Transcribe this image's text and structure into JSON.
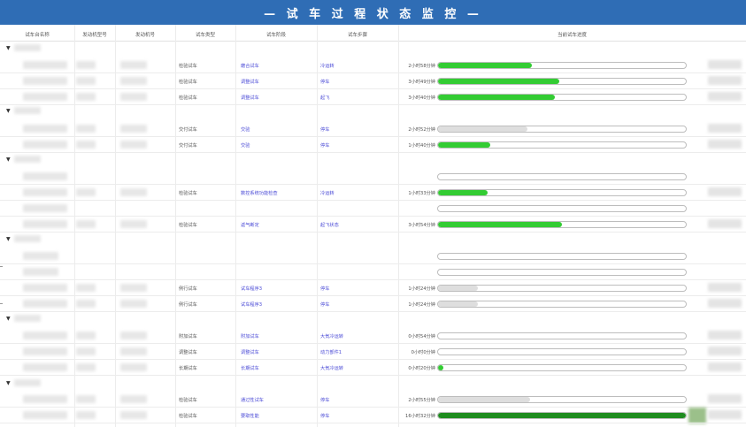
{
  "title": "— 试 车 过 程 状 态 监 控 —",
  "headers": [
    "试车台名称",
    "发动机型号",
    "发动机号",
    "试车类型",
    "试车阶段",
    "试车步骤",
    "当前试车进度"
  ],
  "rows": [
    {
      "type": "检验试车",
      "stage": "磨合试车",
      "step": "冷运转",
      "time": "2小时58分钟",
      "progress": 0.38,
      "color": "green"
    },
    {
      "type": "检验试车",
      "stage": "调整试车",
      "step": "停车",
      "time": "3小时49分钟",
      "progress": 0.49,
      "color": "green"
    },
    {
      "type": "检验试车",
      "stage": "调整试车",
      "step": "起飞",
      "time": "3小时40分钟",
      "progress": 0.47,
      "color": "green"
    },
    {
      "type": "交付试车",
      "stage": "交验",
      "step": "停车",
      "time": "2小时52分钟",
      "progress": 0.36,
      "color": "gray"
    },
    {
      "type": "交付试车",
      "stage": "交验",
      "step": "停车",
      "time": "1小时40分钟",
      "progress": 0.21,
      "color": "green"
    },
    {
      "type": "",
      "stage": "",
      "step": "",
      "time": "",
      "progress": 0,
      "color": "none"
    },
    {
      "type": "检验试车",
      "stage": "数控系统功能检查",
      "step": "冷运转",
      "time": "1小时33分钟",
      "progress": 0.2,
      "color": "green"
    },
    {
      "type": "",
      "stage": "",
      "step": "",
      "time": "",
      "progress": 0,
      "color": "none"
    },
    {
      "type": "检验试车",
      "stage": "返气断定",
      "step": "起飞状态",
      "time": "3小时54分钟",
      "progress": 0.5,
      "color": "green"
    },
    {
      "type": "",
      "stage": "",
      "step": "",
      "time": "",
      "progress": 0,
      "color": "none"
    },
    {
      "type": "",
      "stage": "",
      "step": "",
      "time": "",
      "progress": 0,
      "color": "none"
    },
    {
      "type": "例行试车",
      "stage": "试车程序3",
      "step": "停车",
      "time": "1小时24分钟",
      "progress": 0.16,
      "color": "gray"
    },
    {
      "type": "例行试车",
      "stage": "试车程序3",
      "step": "停车",
      "time": "1小时24分钟",
      "progress": 0.16,
      "color": "gray"
    },
    {
      "type": "附加试车",
      "stage": "附加试车",
      "step": "大気冷运转",
      "time": "0小时54分钟",
      "progress": 0,
      "color": "none"
    },
    {
      "type": "调整试车",
      "stage": "调整试车",
      "step": "动力部件1",
      "time": "0小时0分钟",
      "progress": 0,
      "color": "none"
    },
    {
      "type": "长期试车",
      "stage": "长期试车",
      "step": "大気冷运转",
      "time": "0小时20分钟",
      "progress": 0.02,
      "color": "green"
    },
    {
      "type": "检验试车",
      "stage": "通过性试车",
      "step": "停车",
      "time": "2小时55分钟",
      "progress": 0.37,
      "color": "gray"
    },
    {
      "type": "检验试车",
      "stage": "要取性能",
      "step": "停车",
      "time": "16小时32分钟",
      "progress": 1.0,
      "color": "dark"
    }
  ]
}
